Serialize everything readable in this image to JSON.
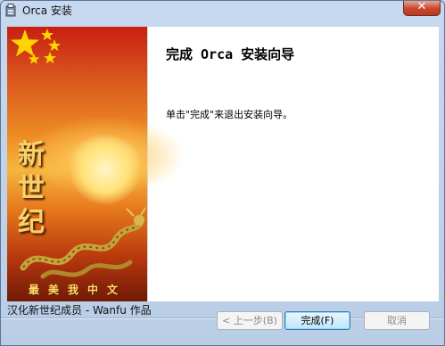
{
  "window": {
    "title": "Orca 安装",
    "close_label": "✕"
  },
  "banner": {
    "chars": [
      "新",
      "世",
      "纪"
    ],
    "slogan": "最美我中文"
  },
  "content": {
    "heading": "完成 Orca 安装向导",
    "message": "单击\"完成\"来退出安装向导。"
  },
  "footer": {
    "credits": "汉化新世纪成员 - Wanfu 作品",
    "back_label": "< 上一步(B)",
    "finish_label": "完成(F)",
    "cancel_label": "取消"
  },
  "colors": {
    "flag_red": "#d0140c",
    "star_yellow": "#ffd400",
    "dragon_gold": "#c9a23a"
  }
}
